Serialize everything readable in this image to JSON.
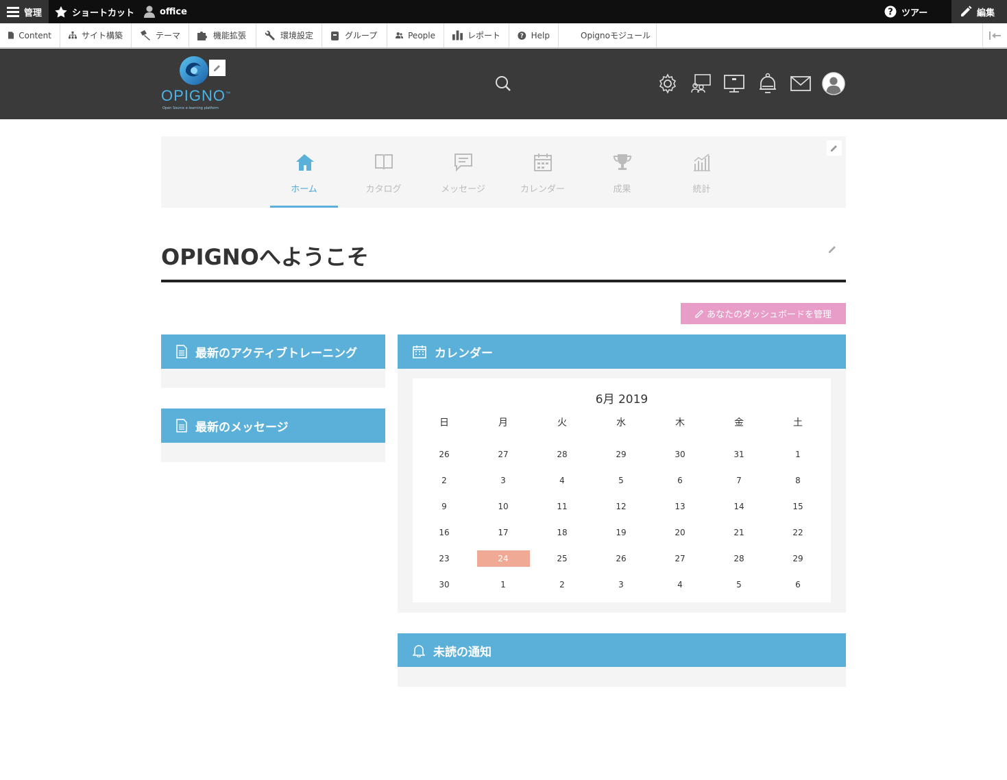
{
  "admin_bar": {
    "manage_label": "管理",
    "shortcuts_label": "ショートカット",
    "user_label": "office",
    "tour_label": "ツアー",
    "edit_label": "編集"
  },
  "tray": {
    "items": [
      {
        "label": "Content",
        "icon": "file-icon"
      },
      {
        "label": "サイト構築",
        "icon": "sitemap-icon"
      },
      {
        "label": "テーマ",
        "icon": "brush-icon"
      },
      {
        "label": "機能拡張",
        "icon": "puzzle-icon"
      },
      {
        "label": "環境設定",
        "icon": "wrench-icon"
      },
      {
        "label": "グループ",
        "icon": "group-icon"
      },
      {
        "label": "People",
        "icon": "people-icon"
      },
      {
        "label": "レポート",
        "icon": "bar-chart-icon"
      },
      {
        "label": "Help",
        "icon": "help-icon"
      },
      {
        "label": "Opignoモジュール",
        "icon": ""
      }
    ]
  },
  "header": {
    "logo_text": "OPIGNO",
    "logo_tm": "™",
    "logo_tagline": "Open Source e-learning platform"
  },
  "tabs": [
    {
      "label": "ホーム",
      "icon": "home-icon",
      "active": true
    },
    {
      "label": "カタログ",
      "icon": "book-icon",
      "active": false
    },
    {
      "label": "メッセージ",
      "icon": "message-icon",
      "active": false
    },
    {
      "label": "カレンダー",
      "icon": "calendar-icon",
      "active": false
    },
    {
      "label": "成果",
      "icon": "trophy-icon",
      "active": false
    },
    {
      "label": "統計",
      "icon": "stats-icon",
      "active": false
    }
  ],
  "page_title": "OPIGNOへようこそ",
  "manage_dashboard_label": "あなたのダッシュボードを管理",
  "blocks": {
    "training": "最新のアクティブトレーニング",
    "messages": "最新のメッセージ",
    "calendar": "カレンダー",
    "notifications": "未読の通知"
  },
  "calendar": {
    "title": "6月 2019",
    "weekdays": [
      "日",
      "月",
      "火",
      "水",
      "木",
      "金",
      "土"
    ],
    "weeks": [
      [
        "26",
        "27",
        "28",
        "29",
        "30",
        "31",
        "1"
      ],
      [
        "2",
        "3",
        "4",
        "5",
        "6",
        "7",
        "8"
      ],
      [
        "9",
        "10",
        "11",
        "12",
        "13",
        "14",
        "15"
      ],
      [
        "16",
        "17",
        "18",
        "19",
        "20",
        "21",
        "22"
      ],
      [
        "23",
        "24",
        "25",
        "26",
        "27",
        "28",
        "29"
      ],
      [
        "30",
        "1",
        "2",
        "3",
        "4",
        "5",
        "6"
      ]
    ],
    "today": "24",
    "today_color": "#f0a994"
  },
  "colors": {
    "accent": "#5ab0d8",
    "manage_button": "#e89cc8",
    "header_bg": "#3a3a3a"
  }
}
